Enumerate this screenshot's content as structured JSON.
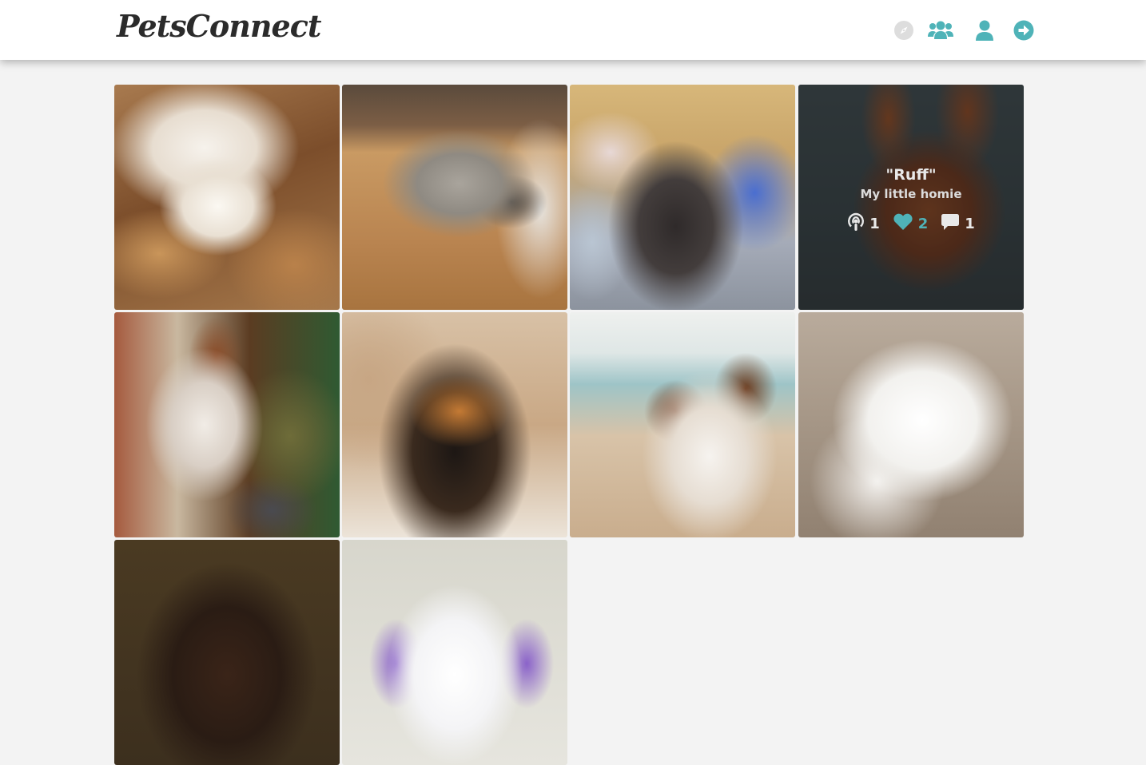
{
  "app": {
    "brand": "PetsConnect",
    "accent_color": "#4fb3b8"
  },
  "nav": {
    "items": [
      {
        "icon": "compass-icon",
        "state": "disabled"
      },
      {
        "icon": "users-icon"
      },
      {
        "icon": "user-icon"
      },
      {
        "icon": "sign-out-icon"
      }
    ]
  },
  "posts": [
    {
      "subject": "bulldog lying in autumn leaves"
    },
    {
      "subject": "fluffy grey dog on wooden floor"
    },
    {
      "subject": "black poodle with knitted toys"
    },
    {
      "subject": "brown chihuahua close-up",
      "hovered": true,
      "overlay": {
        "name": "\"Ruff\"",
        "caption": "My little homie",
        "stats": {
          "follows": "1",
          "likes": "2",
          "comments": "1"
        }
      }
    },
    {
      "subject": "white and brown hound in kitchen"
    },
    {
      "subject": "black and tan fluffy dog smiling"
    },
    {
      "subject": "australian shepherd on beach"
    },
    {
      "subject": "white shiba on pavement"
    },
    {
      "subject": "brown spaniel close-up"
    },
    {
      "subject": "white poodle with purple ears"
    }
  ]
}
